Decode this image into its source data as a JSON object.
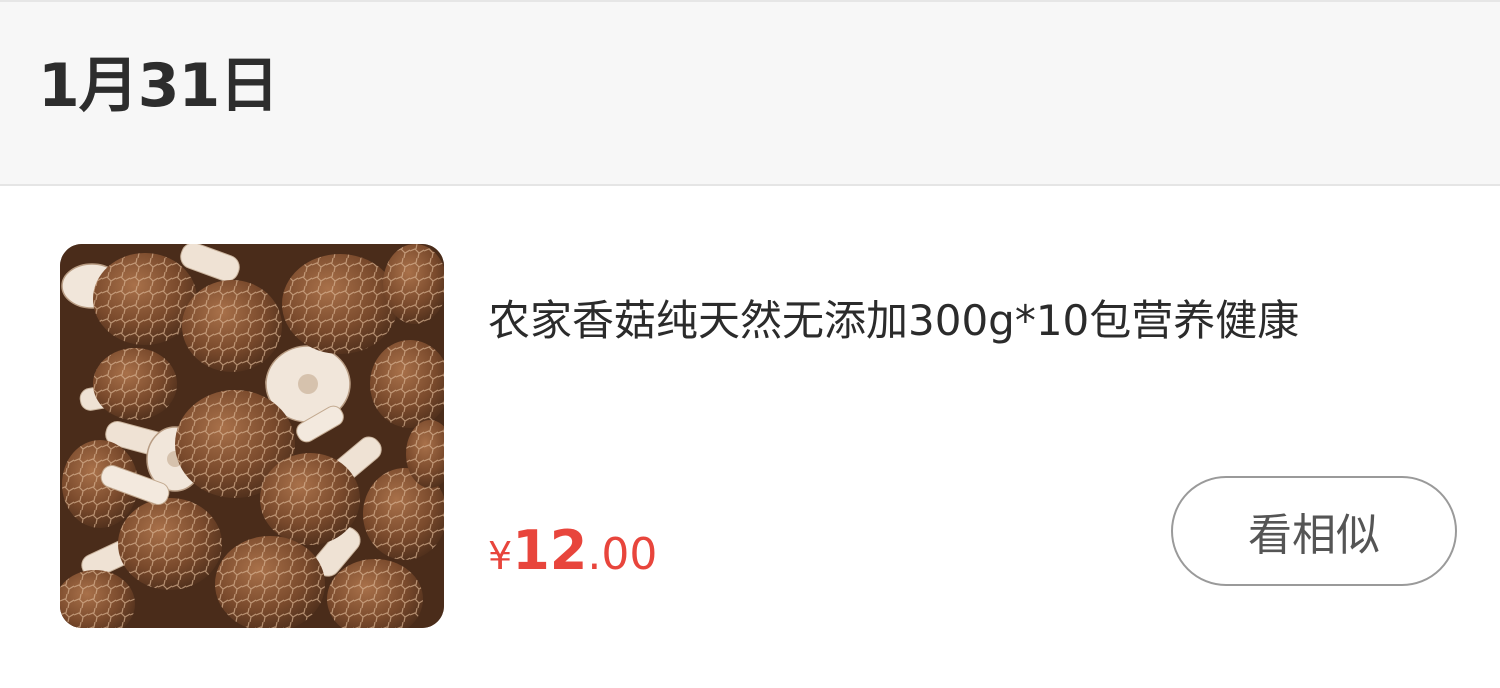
{
  "date_header": {
    "label": "1月31日"
  },
  "product": {
    "image_icon": "mushroom-photo",
    "title": "农家香菇纯天然无添加300g*10包营养健康",
    "price": {
      "currency": "¥",
      "integer": "12",
      "decimal": ".00",
      "color": "#e8453c"
    },
    "similar_button_label": "看相似"
  }
}
